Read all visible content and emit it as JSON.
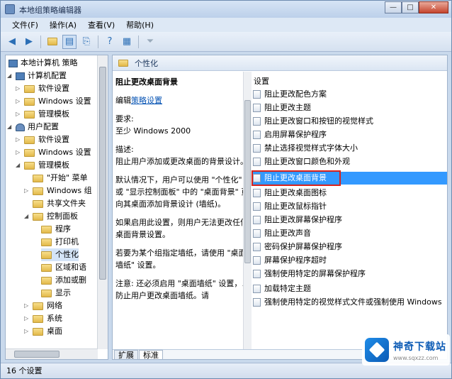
{
  "window": {
    "title": "本地组策略编辑器",
    "buttons": [
      "—",
      "□",
      "✕"
    ]
  },
  "menu": [
    "文件(F)",
    "操作(A)",
    "查看(V)",
    "帮助(H)"
  ],
  "toolbar": [
    "back-arrow-icon",
    "forward-arrow-icon",
    "up-folder-icon",
    "console-tree-icon",
    "export-list-icon",
    "help-icon",
    "properties-icon",
    "filter-icon"
  ],
  "tree": {
    "items": [
      {
        "label": "本地计算机 策略",
        "icon": "computer-policy-icon"
      },
      {
        "label": "计算机配置",
        "icon": "computer-icon",
        "twisty": "◢"
      },
      {
        "label": "软件设置",
        "icon": "folder-icon",
        "twisty": "▷"
      },
      {
        "label": "Windows 设置",
        "icon": "folder-icon",
        "twisty": "▷"
      },
      {
        "label": "管理模板",
        "icon": "folder-icon",
        "twisty": "▷"
      },
      {
        "label": "用户配置",
        "icon": "user-icon",
        "twisty": "◢"
      },
      {
        "label": "软件设置",
        "icon": "folder-icon",
        "twisty": "▷"
      },
      {
        "label": "Windows 设置",
        "icon": "folder-icon",
        "twisty": "▷"
      },
      {
        "label": "管理模板",
        "icon": "folder-icon",
        "twisty": "◢"
      },
      {
        "label": "\"开始\" 菜单",
        "icon": "folder-icon",
        "twisty": ""
      },
      {
        "label": "Windows 组",
        "icon": "folder-icon",
        "twisty": "▷"
      },
      {
        "label": "共享文件夹",
        "icon": "folder-icon",
        "twisty": ""
      },
      {
        "label": "控制面板",
        "icon": "folder-icon",
        "twisty": "◢"
      },
      {
        "label": "程序",
        "icon": "folder-icon",
        "twisty": ""
      },
      {
        "label": "打印机",
        "icon": "folder-icon",
        "twisty": ""
      },
      {
        "label": "个性化",
        "icon": "folder-icon",
        "twisty": ""
      },
      {
        "label": "区域和语",
        "icon": "folder-icon",
        "twisty": ""
      },
      {
        "label": "添加或删",
        "icon": "folder-icon",
        "twisty": ""
      },
      {
        "label": "显示",
        "icon": "folder-icon",
        "twisty": ""
      },
      {
        "label": "网络",
        "icon": "folder-icon",
        "twisty": "▷"
      },
      {
        "label": "系统",
        "icon": "folder-icon",
        "twisty": "▷"
      },
      {
        "label": "桌面",
        "icon": "folder-icon",
        "twisty": "▷"
      }
    ]
  },
  "breadcrumb": "个性化",
  "description": {
    "title": "阻止更改桌面背景",
    "edit_prefix": "编辑",
    "edit_link": "策略设置",
    "req_label": "要求:",
    "req_value": "至少 Windows 2000",
    "desc_label": "描述:",
    "desc_1": "阻止用户添加或更改桌面的背景设计。",
    "desc_2": "默认情况下，用户可以使用 \"个性化\" 或 \"显示控制面板\" 中的 \"桌面背景\" 页向其桌面添加背景设计 (墙纸)。",
    "desc_3": "如果启用此设置，则用户无法更改任何桌面背景设置。",
    "desc_4": "若要为某个组指定墙纸，请使用 \"桌面墙纸\" 设置。",
    "desc_5": "注意: 还必须启用 \"桌面墙纸\" 设置，以防止用户更改桌面墙纸。请"
  },
  "settings": {
    "header": "设置",
    "items": [
      "阻止更改配色方案",
      "阻止更改主题",
      "阻止更改窗口和按钮的视觉样式",
      "启用屏幕保护程序",
      "禁止选择视觉样式字体大小",
      "阻止更改窗口颜色和外观",
      "阻止更改桌面背景",
      "阻止更改桌面图标",
      "阻止更改鼠标指针",
      "阻止更改屏幕保护程序",
      "阻止更改声音",
      "密码保护屏幕保护程序",
      "屏幕保护程序超时",
      "强制使用特定的屏幕保护程序",
      "加载特定主题",
      "强制使用特定的视觉样式文件或强制使用 Windows"
    ],
    "selected_index": 6
  },
  "tabs": [
    "扩展",
    "标准"
  ],
  "status": "16 个设置",
  "watermark": {
    "name": "神奇下载站",
    "url": "www.sqxzz.com"
  }
}
